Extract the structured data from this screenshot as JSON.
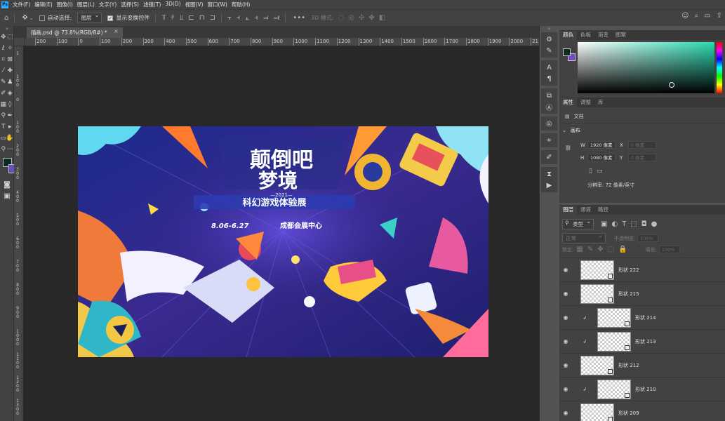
{
  "menubar": {
    "logo": "Ps",
    "items": [
      "文件(F)",
      "编辑(E)",
      "图像(I)",
      "图层(L)",
      "文字(Y)",
      "选择(S)",
      "滤镜(T)",
      "3D(D)",
      "视图(V)",
      "窗口(W)",
      "帮助(H)"
    ]
  },
  "options": {
    "auto_select_label": "自动选择:",
    "auto_select_value": "图层",
    "show_transform_label": "显示变换控件",
    "mode_3d_label": "3D 模式:"
  },
  "document": {
    "tab_title": "插画.psd @ 73.8%(RGB/8#) *"
  },
  "rulers": {
    "h_labels": [
      "200",
      "100",
      "0",
      "100",
      "200",
      "300",
      "400",
      "500",
      "600",
      "700",
      "800",
      "900",
      "1000",
      "1100",
      "1200",
      "1300",
      "1400",
      "1500",
      "1600",
      "1700",
      "1800",
      "1900",
      "2000",
      "21"
    ],
    "v_labels": [
      "1",
      "1 0 0",
      "0",
      "1 0 0",
      "2 0 0",
      "3 0 0",
      "4 0 0",
      "5 0 0",
      "6 0 0",
      "7 0 0",
      "8 0 0",
      "9 0 0",
      "1 0 0 0",
      "1 1 0 0",
      "1 2 0 0",
      "1 3 0 0"
    ]
  },
  "swatches": {
    "foreground": "#0d2a25",
    "background": "#6f4bc1"
  },
  "artwork": {
    "title_line1": "颠倒吧",
    "title_line2": "梦境",
    "year": "—2021—",
    "subtitle": "科幻游戏体验展",
    "dates": "8.06-6.27",
    "venue": "成都会展中心"
  },
  "color_panel": {
    "tabs": [
      "颜色",
      "色板",
      "渐变",
      "图案"
    ],
    "active_tab": "颜色"
  },
  "properties_panel": {
    "tabs": [
      "属性",
      "调整",
      "库"
    ],
    "doc_label": "文档",
    "section": "画布",
    "w_label": "W",
    "w_value": "1920 像素",
    "h_label": "H",
    "h_value": "1080 像素",
    "x_label": "X",
    "x_value": "0 像素",
    "y_label": "Y",
    "y_value": "0 像素",
    "resolution": "分辨率: 72 像素/英寸"
  },
  "layers_panel": {
    "tabs": [
      "图层",
      "通道",
      "路径"
    ],
    "filter_type": "类型",
    "blend_mode": "正常",
    "opacity_label": "不透明度:",
    "opacity_value": "100%",
    "lock_label": "锁定:",
    "fill_label": "填充:",
    "fill_value": "100%",
    "layers": [
      {
        "name": "形状 222",
        "clipped": false
      },
      {
        "name": "形状 215",
        "clipped": false
      },
      {
        "name": "形状 214",
        "clipped": true
      },
      {
        "name": "形状 213",
        "clipped": true
      },
      {
        "name": "形状 212",
        "clipped": false
      },
      {
        "name": "形状 210",
        "clipped": true
      },
      {
        "name": "形状 209",
        "clipped": false
      }
    ]
  }
}
